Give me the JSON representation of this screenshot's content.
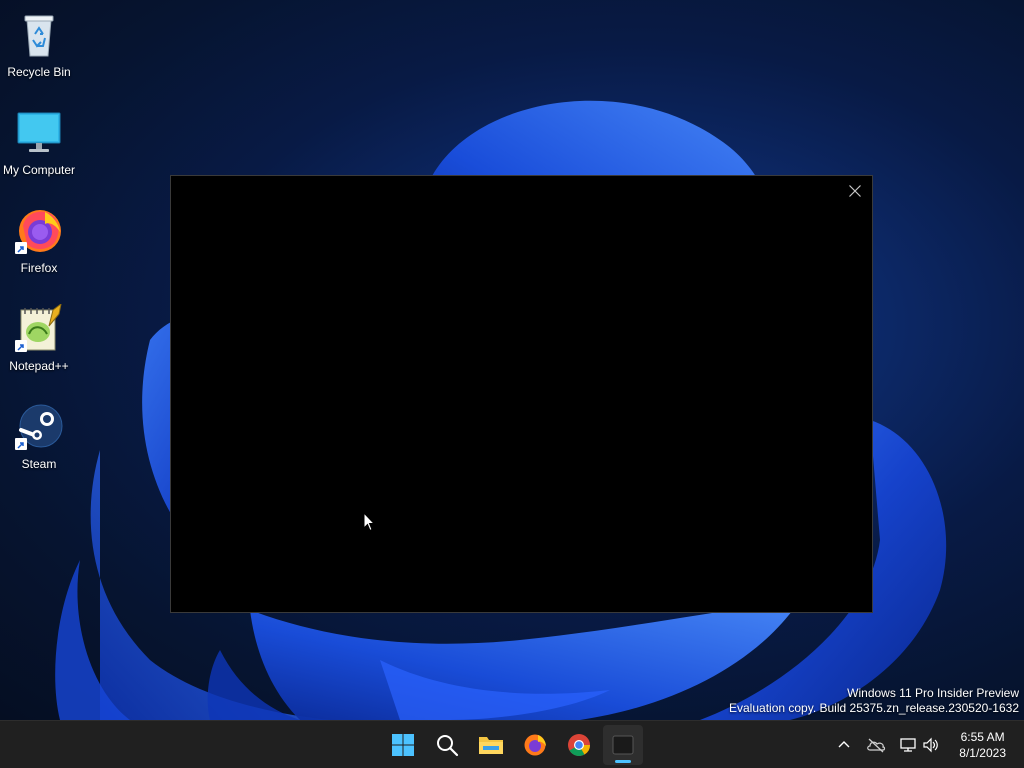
{
  "desktop": {
    "icons": [
      {
        "label": "Recycle Bin"
      },
      {
        "label": "My Computer"
      },
      {
        "label": "Firefox"
      },
      {
        "label": "Notepad++"
      },
      {
        "label": "Steam"
      }
    ],
    "watermark": {
      "line1": "Windows 11 Pro Insider Preview",
      "line2": "Evaluation copy. Build 25375.zn_release.230520-1632"
    }
  },
  "window": {
    "close_icon": "close-icon"
  },
  "taskbar": {
    "apps": [
      "start-icon",
      "search-icon",
      "file-explorer-icon",
      "firefox-icon",
      "chrome-icon",
      "terminal-icon"
    ],
    "tray": [
      "chevron-up-icon",
      "onedrive-offline-icon",
      "network-icon",
      "volume-icon"
    ],
    "clock": {
      "time": "6:55 AM",
      "date": "8/1/2023"
    }
  },
  "colors": {
    "taskbar_bg": "#202020",
    "accent": "#4cc2ff",
    "window_bg": "#000000",
    "wallpaper_blue": "#1f5fff"
  }
}
